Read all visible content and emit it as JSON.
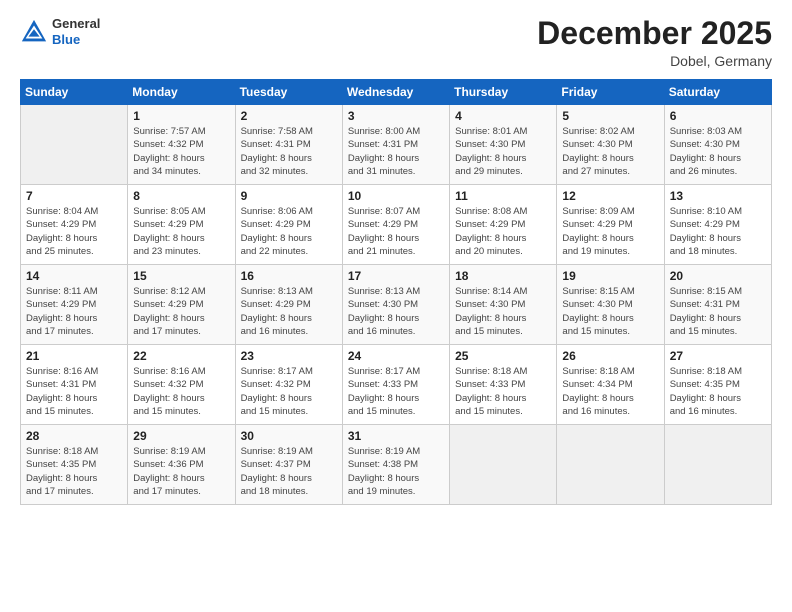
{
  "header": {
    "logo_general": "General",
    "logo_blue": "Blue",
    "title": "December 2025",
    "subtitle": "Dobel, Germany"
  },
  "weekdays": [
    "Sunday",
    "Monday",
    "Tuesday",
    "Wednesday",
    "Thursday",
    "Friday",
    "Saturday"
  ],
  "weeks": [
    [
      {
        "day": "",
        "info": ""
      },
      {
        "day": "1",
        "info": "Sunrise: 7:57 AM\nSunset: 4:32 PM\nDaylight: 8 hours\nand 34 minutes."
      },
      {
        "day": "2",
        "info": "Sunrise: 7:58 AM\nSunset: 4:31 PM\nDaylight: 8 hours\nand 32 minutes."
      },
      {
        "day": "3",
        "info": "Sunrise: 8:00 AM\nSunset: 4:31 PM\nDaylight: 8 hours\nand 31 minutes."
      },
      {
        "day": "4",
        "info": "Sunrise: 8:01 AM\nSunset: 4:30 PM\nDaylight: 8 hours\nand 29 minutes."
      },
      {
        "day": "5",
        "info": "Sunrise: 8:02 AM\nSunset: 4:30 PM\nDaylight: 8 hours\nand 27 minutes."
      },
      {
        "day": "6",
        "info": "Sunrise: 8:03 AM\nSunset: 4:30 PM\nDaylight: 8 hours\nand 26 minutes."
      }
    ],
    [
      {
        "day": "7",
        "info": "Sunrise: 8:04 AM\nSunset: 4:29 PM\nDaylight: 8 hours\nand 25 minutes."
      },
      {
        "day": "8",
        "info": "Sunrise: 8:05 AM\nSunset: 4:29 PM\nDaylight: 8 hours\nand 23 minutes."
      },
      {
        "day": "9",
        "info": "Sunrise: 8:06 AM\nSunset: 4:29 PM\nDaylight: 8 hours\nand 22 minutes."
      },
      {
        "day": "10",
        "info": "Sunrise: 8:07 AM\nSunset: 4:29 PM\nDaylight: 8 hours\nand 21 minutes."
      },
      {
        "day": "11",
        "info": "Sunrise: 8:08 AM\nSunset: 4:29 PM\nDaylight: 8 hours\nand 20 minutes."
      },
      {
        "day": "12",
        "info": "Sunrise: 8:09 AM\nSunset: 4:29 PM\nDaylight: 8 hours\nand 19 minutes."
      },
      {
        "day": "13",
        "info": "Sunrise: 8:10 AM\nSunset: 4:29 PM\nDaylight: 8 hours\nand 18 minutes."
      }
    ],
    [
      {
        "day": "14",
        "info": "Sunrise: 8:11 AM\nSunset: 4:29 PM\nDaylight: 8 hours\nand 17 minutes."
      },
      {
        "day": "15",
        "info": "Sunrise: 8:12 AM\nSunset: 4:29 PM\nDaylight: 8 hours\nand 17 minutes."
      },
      {
        "day": "16",
        "info": "Sunrise: 8:13 AM\nSunset: 4:29 PM\nDaylight: 8 hours\nand 16 minutes."
      },
      {
        "day": "17",
        "info": "Sunrise: 8:13 AM\nSunset: 4:30 PM\nDaylight: 8 hours\nand 16 minutes."
      },
      {
        "day": "18",
        "info": "Sunrise: 8:14 AM\nSunset: 4:30 PM\nDaylight: 8 hours\nand 15 minutes."
      },
      {
        "day": "19",
        "info": "Sunrise: 8:15 AM\nSunset: 4:30 PM\nDaylight: 8 hours\nand 15 minutes."
      },
      {
        "day": "20",
        "info": "Sunrise: 8:15 AM\nSunset: 4:31 PM\nDaylight: 8 hours\nand 15 minutes."
      }
    ],
    [
      {
        "day": "21",
        "info": "Sunrise: 8:16 AM\nSunset: 4:31 PM\nDaylight: 8 hours\nand 15 minutes."
      },
      {
        "day": "22",
        "info": "Sunrise: 8:16 AM\nSunset: 4:32 PM\nDaylight: 8 hours\nand 15 minutes."
      },
      {
        "day": "23",
        "info": "Sunrise: 8:17 AM\nSunset: 4:32 PM\nDaylight: 8 hours\nand 15 minutes."
      },
      {
        "day": "24",
        "info": "Sunrise: 8:17 AM\nSunset: 4:33 PM\nDaylight: 8 hours\nand 15 minutes."
      },
      {
        "day": "25",
        "info": "Sunrise: 8:18 AM\nSunset: 4:33 PM\nDaylight: 8 hours\nand 15 minutes."
      },
      {
        "day": "26",
        "info": "Sunrise: 8:18 AM\nSunset: 4:34 PM\nDaylight: 8 hours\nand 16 minutes."
      },
      {
        "day": "27",
        "info": "Sunrise: 8:18 AM\nSunset: 4:35 PM\nDaylight: 8 hours\nand 16 minutes."
      }
    ],
    [
      {
        "day": "28",
        "info": "Sunrise: 8:18 AM\nSunset: 4:35 PM\nDaylight: 8 hours\nand 17 minutes."
      },
      {
        "day": "29",
        "info": "Sunrise: 8:19 AM\nSunset: 4:36 PM\nDaylight: 8 hours\nand 17 minutes."
      },
      {
        "day": "30",
        "info": "Sunrise: 8:19 AM\nSunset: 4:37 PM\nDaylight: 8 hours\nand 18 minutes."
      },
      {
        "day": "31",
        "info": "Sunrise: 8:19 AM\nSunset: 4:38 PM\nDaylight: 8 hours\nand 19 minutes."
      },
      {
        "day": "",
        "info": ""
      },
      {
        "day": "",
        "info": ""
      },
      {
        "day": "",
        "info": ""
      }
    ]
  ]
}
